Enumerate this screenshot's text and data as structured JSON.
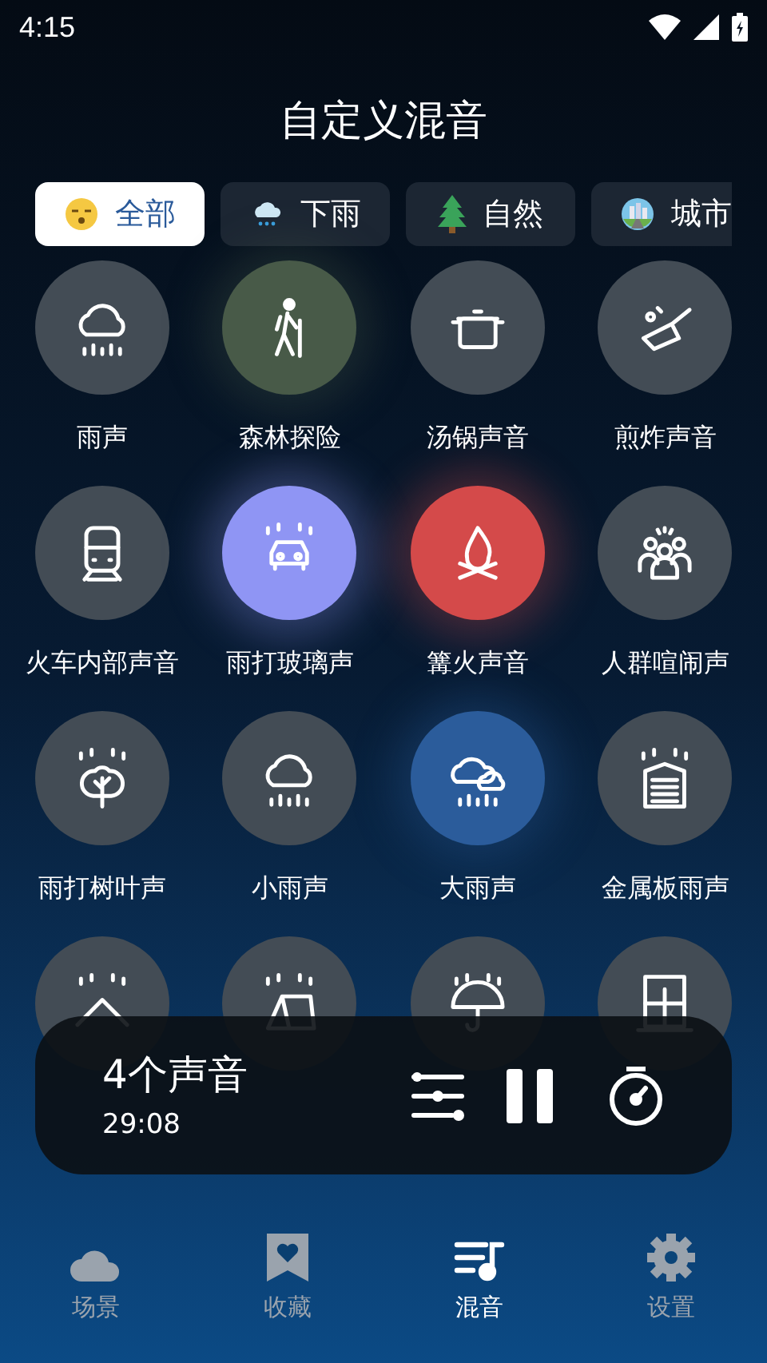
{
  "status_bar": {
    "time": "4:15"
  },
  "title": "自定义混音",
  "tabs": [
    {
      "label": "全部",
      "selected": true
    },
    {
      "label": "下雨",
      "selected": false
    },
    {
      "label": "自然",
      "selected": false
    },
    {
      "label": "城市",
      "selected": false
    }
  ],
  "sounds": [
    {
      "name": "雨声",
      "selected": false
    },
    {
      "name": "森林探险",
      "selected": true,
      "color": "#485a48"
    },
    {
      "name": "汤锅声音",
      "selected": false
    },
    {
      "name": "煎炸声音",
      "selected": false
    },
    {
      "name": "火车内部声音",
      "selected": false
    },
    {
      "name": "雨打玻璃声",
      "selected": true,
      "color": "#8f95f4"
    },
    {
      "name": "篝火声音",
      "selected": true,
      "color": "#d44a4a"
    },
    {
      "name": "人群喧闹声",
      "selected": false
    },
    {
      "name": "雨打树叶声",
      "selected": false
    },
    {
      "name": "小雨声",
      "selected": false
    },
    {
      "name": "大雨声",
      "selected": true,
      "color": "#2b5c9b"
    },
    {
      "name": "金属板雨声",
      "selected": false
    },
    {
      "selected": false
    },
    {
      "selected": false
    },
    {
      "selected": false
    },
    {
      "selected": false
    }
  ],
  "player": {
    "count": "4个声音",
    "time": "29:08"
  },
  "bottom_nav": [
    {
      "label": "场景",
      "selected": false
    },
    {
      "label": "收藏",
      "selected": false
    },
    {
      "label": "混音",
      "selected": true
    },
    {
      "label": "设置",
      "selected": false
    }
  ]
}
